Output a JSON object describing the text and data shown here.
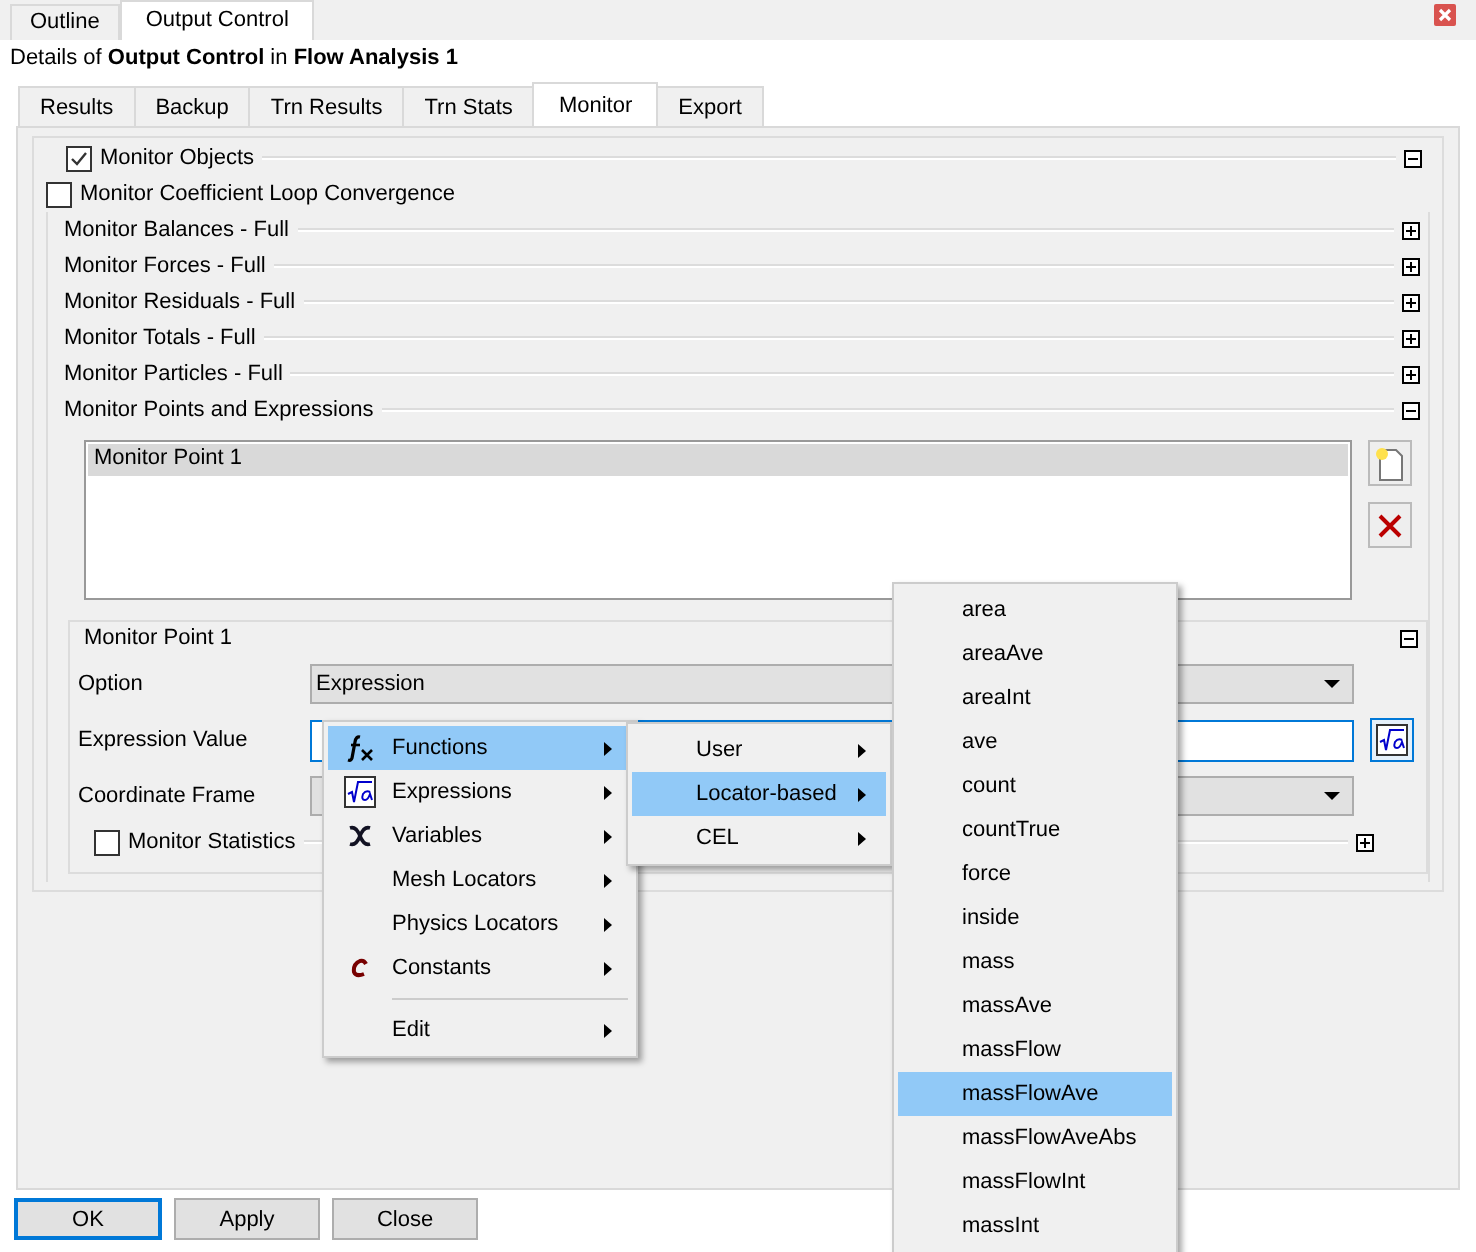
{
  "top_tabs": [
    {
      "label": "Outline",
      "selected": false
    },
    {
      "label": "Output Control",
      "selected": true
    }
  ],
  "header": "Details of **Output Control** in **Flow Analysis 1**",
  "tabs": [
    {
      "label": "Results",
      "selected": false
    },
    {
      "label": "Backup",
      "selected": false
    },
    {
      "label": "Trn Results",
      "selected": false
    },
    {
      "label": "Trn Stats",
      "selected": false
    },
    {
      "label": "Monitor",
      "selected": true
    },
    {
      "label": "Export",
      "selected": false
    }
  ],
  "monitor_objects": {
    "label": "Monitor Objects",
    "checked": true,
    "expanded": true
  },
  "loop_convergence": {
    "label": "Monitor Coefficient Loop Convergence",
    "checked": false
  },
  "sections": [
    {
      "label": "Monitor Balances - Full",
      "expanded": false
    },
    {
      "label": "Monitor Forces - Full",
      "expanded": false
    },
    {
      "label": "Monitor Residuals - Full",
      "expanded": false
    },
    {
      "label": "Monitor Totals - Full",
      "expanded": false
    },
    {
      "label": "Monitor Particles - Full",
      "expanded": false
    },
    {
      "label": "Monitor Points and Expressions",
      "expanded": true
    }
  ],
  "point_list": [
    {
      "label": "Monitor Point 1",
      "selected": true
    }
  ],
  "point_group": {
    "title": "Monitor Point 1",
    "expanded": true,
    "fields": [
      {
        "kind": "dropdown",
        "label": "Option",
        "value": "Expression"
      },
      {
        "kind": "text",
        "label": "Expression Value"
      },
      {
        "kind": "dropdown",
        "label": "Coordinate Frame"
      }
    ],
    "statistics": {
      "label": "Monitor Statistics",
      "checked": false,
      "expanded": false
    }
  },
  "buttons": [
    {
      "label": "OK",
      "focused": true
    },
    {
      "label": "Apply",
      "focused": false
    },
    {
      "label": "Close",
      "focused": false
    }
  ],
  "menu": [
    {
      "kind": "functions",
      "label": "Functions",
      "selected": true
    },
    {
      "kind": "expressions",
      "label": "Expressions",
      "selected": false
    },
    {
      "kind": "variables",
      "label": "Variables",
      "selected": false
    },
    {
      "kind": "plain",
      "label": "Mesh Locators",
      "selected": false
    },
    {
      "kind": "plain",
      "label": "Physics Locators",
      "selected": false
    },
    {
      "kind": "constants",
      "label": "Constants",
      "selected": false
    },
    {
      "kind": "separator"
    },
    {
      "kind": "plain",
      "label": "Edit",
      "selected": false
    }
  ],
  "submenu": [
    {
      "label": "User",
      "selected": false
    },
    {
      "label": "Locator-based",
      "selected": true
    },
    {
      "label": "CEL",
      "selected": false
    }
  ],
  "function_list": [
    {
      "label": "area",
      "selected": false
    },
    {
      "label": "areaAve",
      "selected": false
    },
    {
      "label": "areaInt",
      "selected": false
    },
    {
      "label": "ave",
      "selected": false
    },
    {
      "label": "count",
      "selected": false
    },
    {
      "label": "countTrue",
      "selected": false
    },
    {
      "label": "force",
      "selected": false
    },
    {
      "label": "inside",
      "selected": false
    },
    {
      "label": "mass",
      "selected": false
    },
    {
      "label": "massAve",
      "selected": false
    },
    {
      "label": "massFlow",
      "selected": false
    },
    {
      "label": "massFlowAve",
      "selected": true
    },
    {
      "label": "massFlowAveAbs",
      "selected": false
    },
    {
      "label": "massFlowInt",
      "selected": false
    },
    {
      "label": "massInt",
      "selected": false
    }
  ]
}
